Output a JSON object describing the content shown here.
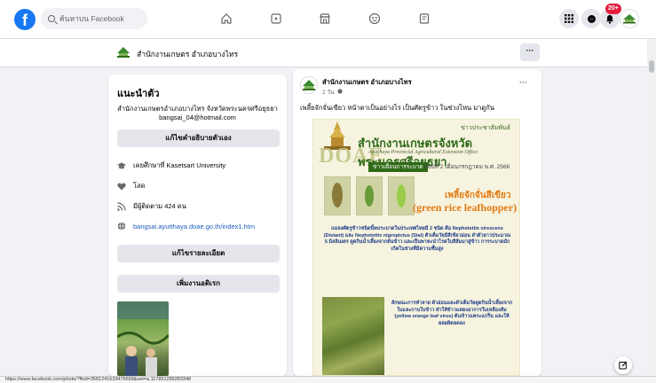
{
  "topbar": {
    "logo": "f",
    "search_placeholder": "ค้นหาบน Facebook",
    "nav_icons": [
      "home-icon",
      "watch-icon",
      "marketplace-icon",
      "groups-icon",
      "gaming-icon"
    ],
    "notification_count": "20+"
  },
  "page_header": {
    "title": "สำนักงานเกษตร อำเภอบางไทร",
    "more_label": "···"
  },
  "intro": {
    "heading": "แนะนำตัว",
    "bio_line1": "สำนักงานเกษตรอำเภอบางไทร จังหวัดพระนครศรีอยุธยา",
    "bio_line2": "bangsai_04@hotmail.com",
    "edit_bio_button": "แก้ไขคำอธิบายตัวเอง",
    "education": "เคยศึกษาที่ Kasetsart University",
    "relationship": "โสด",
    "followers": "มีผู้ติดตาม 424 คน",
    "website": "bangsai.ayutthaya.doae.go.th/index1.htm",
    "edit_details_button": "แก้ไขรายละเอียด",
    "add_featured_button": "เพิ่มงานอดิเรก"
  },
  "post": {
    "author": "สำนักงานเกษตร อำเภอบางไทร",
    "time": "2 วัน",
    "more_label": "···",
    "caption": "เพลี้ยจักจั่นเขียว หน้าตาเป็นอย่างไร เป็นศัตรูข้าว ในช่วงไหน มาดูกัน"
  },
  "poster": {
    "top_label": "ข่าวประชาสัมพันธ์",
    "title": "สำนักงานเกษตรจังหวัดพระนครศรีอยุธยา",
    "subtitle": "Ayutthaya Provincial Agricultural Extension Office",
    "brand": "DOAE",
    "tag": "ข่าวเตือนการระบาด",
    "issue": "ฉบับที่ 2 เดือนกรกฎาคม พ.ศ. 2566",
    "pest_thai": "เพลี้ยจักจั่นสีเขียว",
    "pest_en": "(green rice leafhopper)",
    "body1": "แมลงศัตรูข้าวชนิดนี้พบระบาดในประเทศไทยมี 2 ชนิด คือ Nephotettix virescens (Distant) และ Nephotettix nigropictus (Stal) ตัวเต็มวัยมีสีเขียวอ่อน ลำตัวยาวประมาณ 5 มิลลิเมตร ดูดกินน้ำเลี้ยงจากต้นข้าว และเป็นพาหะนำโรคใบสีส้มมาสู่ข้าว การระบาดมักเกิดในช่วงที่มีความชื้นสูง",
    "body2": "ลักษณะการทำลาย ตัวอ่อนและตัวเต็มวัยดูดกินน้ำเลี้ยงจากใบและกาบใบข้าว ทำให้ข้าวแสดงอาการใบเหลืองส้ม (yellow orange leaf virus) ต้นข้าวแคระแกร็น และให้ผลผลิตลดลง"
  },
  "statusbar": {
    "url": "https://www.facebook.com/photo/?fbid=3581241633476658&set=a.117891289283348"
  }
}
